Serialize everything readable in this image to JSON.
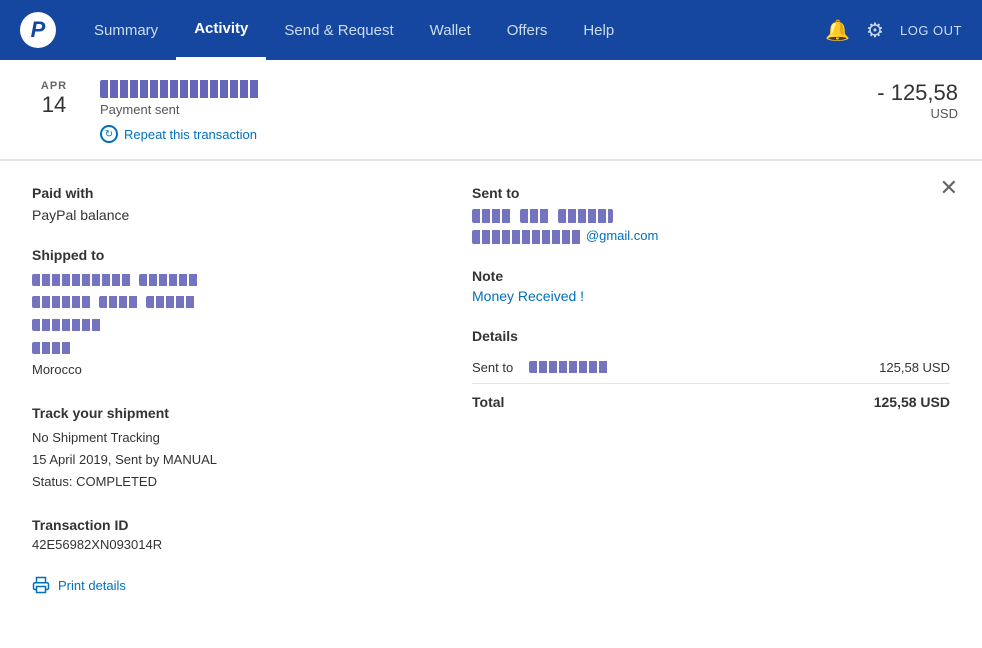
{
  "navbar": {
    "links": [
      {
        "id": "summary",
        "label": "Summary",
        "active": false
      },
      {
        "id": "activity",
        "label": "Activity",
        "active": true
      },
      {
        "id": "send-request",
        "label": "Send & Request",
        "active": false
      },
      {
        "id": "wallet",
        "label": "Wallet",
        "active": false
      },
      {
        "id": "offers",
        "label": "Offers",
        "active": false
      },
      {
        "id": "help",
        "label": "Help",
        "active": false
      }
    ],
    "logout_label": "LOG OUT"
  },
  "transaction": {
    "date_month": "APR",
    "date_day": "14",
    "status": "Payment sent",
    "repeat_label": "Repeat this transaction",
    "amount": "- 125,58",
    "currency": "USD"
  },
  "detail": {
    "paid_with_label": "Paid with",
    "paid_with_value": "PayPal balance",
    "shipped_to_label": "Shipped to",
    "shipped_lines": [
      "[name redacted]",
      "[street redacted]",
      "[city redacted]",
      "[zip redacted]",
      "Morocco"
    ],
    "track_label": "Track your shipment",
    "track_no_tracking": "No Shipment Tracking",
    "track_date": "15 April 2019, Sent by MANUAL",
    "track_status": "Status: COMPLETED",
    "tid_label": "Transaction ID",
    "tid_value": "42E56982XN093014R",
    "print_label": "Print details",
    "sent_to_label": "Sent to",
    "note_label": "Note",
    "note_value": "Money Received !",
    "details_label": "Details",
    "sent_to_row_label": "Sent to",
    "sent_to_amount": "125,58 USD",
    "total_label": "Total",
    "total_amount": "125,58 USD"
  }
}
